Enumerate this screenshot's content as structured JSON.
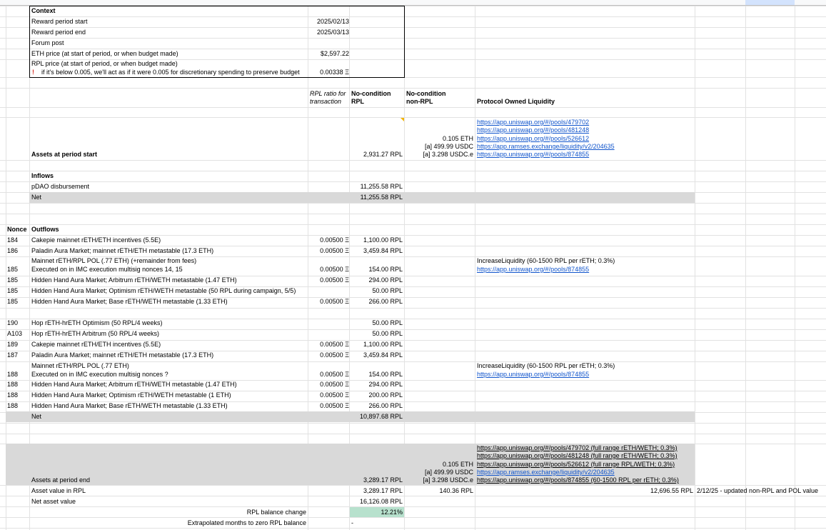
{
  "context": {
    "title": "Context",
    "rows": [
      {
        "label": "Reward period start",
        "value": "2025/02/13"
      },
      {
        "label": "Reward period end",
        "value": "2025/03/13"
      },
      {
        "label": "Forum post",
        "value": ""
      },
      {
        "label": "ETH price (at start of period, or when budget made)",
        "value": "$2,597.22"
      },
      {
        "label": "RPL price (at start of period, or when budget made)",
        "value": ""
      }
    ],
    "warning": "if it's below 0.005, we'll act as if it were 0.005 for discretionary spending to preserve budget",
    "rpl_price": "0.00338 Ξ"
  },
  "columns": {
    "ratio_line1": "RPL ratio for",
    "ratio_line2": "transaction",
    "nc_rpl_line1": "No-condition",
    "nc_rpl_line2": "RPL",
    "nc_nonrpl_line1": "No-condition",
    "nc_nonrpl_line2": "non-RPL",
    "pol": "Protocol Owned Liquidity",
    "nonce": "Nonce"
  },
  "assets_start": {
    "label": "Assets at period start",
    "rpl": "2,931.27 RPL",
    "nonrpl": [
      "0.105 ETH",
      "[a] 499.99 USDC",
      "[a] 3.298 USDC.e"
    ],
    "links": [
      "https://app.uniswap.org/#/pools/479702",
      "https://app.uniswap.org/#/pools/481248",
      "https://app.uniswap.org/#/pools/526612",
      "https://app.ramses.exchange/liquidity/v2/204635",
      "https://app.uniswap.org/#/pools/874855"
    ]
  },
  "inflows": {
    "title": "Inflows",
    "rows": [
      {
        "label": "pDAO disbursement",
        "rpl": "11,255.58 RPL"
      }
    ],
    "net_label": "Net",
    "net": "11,255.58 RPL"
  },
  "outflows": {
    "title": "Outflows",
    "rows": [
      {
        "nonce": "184",
        "label": "Cakepie mainnet rETH/ETH incentives (5.5E)",
        "ratio": "0.00500 Ξ",
        "rpl": "1,100.00 RPL"
      },
      {
        "nonce": "186",
        "label": "Paladin Aura Market; mainnet rETH/ETH metastable (17.3 ETH)",
        "ratio": "0.00500 Ξ",
        "rpl": "3,459.84 RPL"
      },
      {
        "nonce": "185",
        "label": "Mainnet rETH/RPL POL (.77 ETH) (+remainder from fees)",
        "label2": "Executed on in IMC execution multisig nonces 14, 15",
        "ratio": "0.00500 Ξ",
        "rpl": "154.00 RPL",
        "note": "IncreaseLiquidity (60-1500 RPL per rETH; 0.3%)",
        "link": "https://app.uniswap.org/#/pools/874855"
      },
      {
        "nonce": "185",
        "label": "Hidden Hand Aura Market; Arbitrum rETH/WETH metastable (1.47 ETH)",
        "ratio": "0.00500 Ξ",
        "rpl": "294.00 RPL"
      },
      {
        "nonce": "185",
        "label": "Hidden Hand Aura Market; Optimism rETH/WETH metastable (50 RPL during campaign, 5/5)",
        "ratio": "",
        "rpl": "50.00 RPL"
      },
      {
        "nonce": "185",
        "label": "Hidden Hand Aura Market; Base rETH/WETH metastable (1.33 ETH)",
        "ratio": "0.00500 Ξ",
        "rpl": "266.00 RPL"
      },
      {
        "nonce": "190",
        "label": "Hop rETH-hrETH Optimism (50 RPL/4 weeks)",
        "ratio": "",
        "rpl": "50.00 RPL"
      },
      {
        "nonce": "A103",
        "label": "Hop rETH-hrETH Arbitrum (50 RPL/4 weeks)",
        "ratio": "",
        "rpl": "50.00 RPL"
      },
      {
        "nonce": "189",
        "label": "Cakepie mainnet rETH/ETH incentives (5.5E)",
        "ratio": "0.00500 Ξ",
        "rpl": "1,100.00 RPL"
      },
      {
        "nonce": "187",
        "label": "Paladin Aura Market; mainnet rETH/ETH metastable (17.3 ETH)",
        "ratio": "0.00500 Ξ",
        "rpl": "3,459.84 RPL"
      },
      {
        "nonce": "188",
        "label": "Mainnet rETH/RPL POL (.77 ETH)",
        "label2": "Executed on in IMC execution multisig nonces ?",
        "ratio": "0.00500 Ξ",
        "rpl": "154.00 RPL",
        "note": "IncreaseLiquidity (60-1500 RPL per rETH; 0.3%)",
        "link": "https://app.uniswap.org/#/pools/874855"
      },
      {
        "nonce": "188",
        "label": "Hidden Hand Aura Market; Arbitrum rETH/WETH metastable (1.47 ETH)",
        "ratio": "0.00500 Ξ",
        "rpl": "294.00 RPL"
      },
      {
        "nonce": "188",
        "label": "Hidden Hand Aura Market; Optimism rETH/WETH metastable (1 ETH)",
        "ratio": "0.00500 Ξ",
        "rpl": "200.00 RPL"
      },
      {
        "nonce": "188",
        "label": "Hidden Hand Aura Market; Base rETH/WETH metastable (1.33 ETH)",
        "ratio": "0.00500 Ξ",
        "rpl": "266.00 RPL"
      }
    ],
    "net_label": "Net",
    "net": "10,897.68 RPL"
  },
  "assets_end": {
    "label": "Assets at period end",
    "rpl": "3,289.17 RPL",
    "nonrpl": [
      "0.105 ETH",
      "[a] 499.99 USDC",
      "[a] 3.298 USDC.e"
    ],
    "links": [
      "https://app.uniswap.org/#/pools/479702 (full range rETH/WETH; 0.3%)",
      "https://app.uniswap.org/#/pools/481248 (full range rETH/WETH; 0.3%)",
      "https://app.uniswap.org/#/pools/526612 (full range RPL/WETH; 0.3%)",
      "https://app.ramses.exchange/liquidity/v2/204635",
      "https://app.uniswap.org/#/pools/874855 (60-1500 RPL per rETH; 0.3%)"
    ]
  },
  "summary": {
    "value_label": "Asset value in RPL",
    "value_rpl": "3,289.17 RPL",
    "value_nonrpl": "140.36 RPL",
    "value_pol": "12,696.55 RPL",
    "value_note": "2/12/25 - updated non-RPL and POL value",
    "nav_label": "Net asset value",
    "nav": "16,126.08 RPL",
    "change_label": "RPL balance change",
    "change": "12.21%",
    "extrap_label": "Extrapolated months to zero RPL balance",
    "extrap": "-"
  },
  "colors": {
    "link": "#1155cc",
    "net_fill": "#d9d9d9",
    "positive_fill": "#b7e1cd",
    "warning": "#d93025",
    "comment_marker": "#f4b400"
  }
}
